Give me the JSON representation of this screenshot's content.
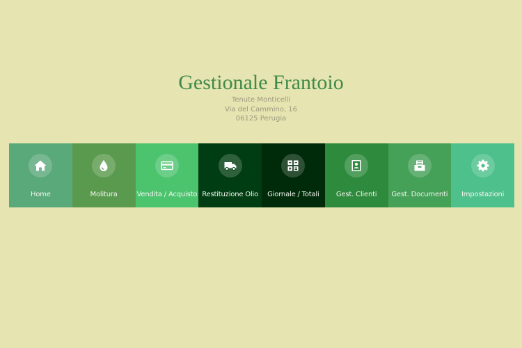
{
  "header": {
    "title": "Gestionale Frantoio",
    "company": "Tenute Monticelli",
    "address": "Via del Cammino, 16",
    "city": "06125 Perugia"
  },
  "nav": [
    {
      "label": "Home",
      "icon": "home-icon",
      "color": "#5aa97a"
    },
    {
      "label": "Molitura",
      "icon": "drop-icon",
      "color": "#5a9a4e"
    },
    {
      "label": "Vendita / Acquisto",
      "icon": "credit-card-icon",
      "color": "#4cc46e"
    },
    {
      "label": "Restituzione Olio",
      "icon": "truck-icon",
      "color": "#003d12"
    },
    {
      "label": "Giornale / Totali",
      "icon": "calculator-icon",
      "color": "#002b0a"
    },
    {
      "label": "Gest. Clienti",
      "icon": "contact-card-icon",
      "color": "#2e8a3c"
    },
    {
      "label": "Gest. Documenti",
      "icon": "archive-icon",
      "color": "#45a058"
    },
    {
      "label": "Impostazioni",
      "icon": "gear-icon",
      "color": "#4ec08c"
    }
  ]
}
